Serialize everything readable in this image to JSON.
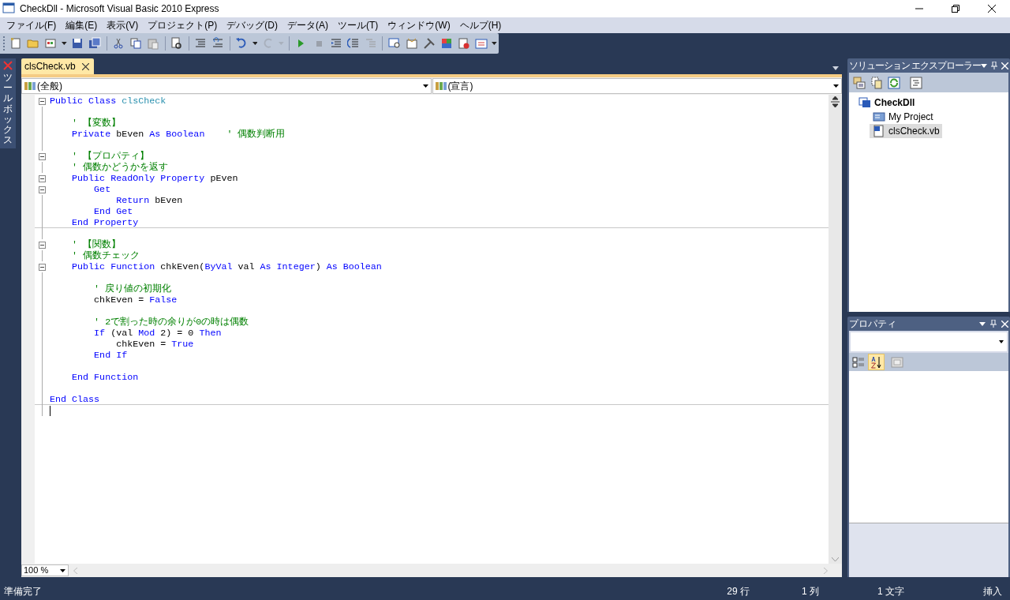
{
  "window": {
    "title": "CheckDll - Microsoft Visual Basic 2010 Express"
  },
  "menu": [
    "ファイル(F)",
    "編集(E)",
    "表示(V)",
    "プロジェクト(P)",
    "デバッグ(D)",
    "データ(A)",
    "ツール(T)",
    "ウィンドウ(W)",
    "ヘルプ(H)"
  ],
  "toolbox_tab": "ツールボックス",
  "document_tabs": [
    {
      "label": "clsCheck.vb",
      "selected": true
    }
  ],
  "editor": {
    "object_dropdown": "(全般)",
    "member_dropdown": "(宣言)",
    "zoom": "100 %",
    "lines": [
      {
        "fold": true,
        "separator": false,
        "tokens": [
          {
            "kind": "keyword",
            "text": "Public Class "
          },
          {
            "kind": "type",
            "text": "clsCheck"
          }
        ]
      },
      {
        "fold": false,
        "separator": false
      },
      {
        "fold": false,
        "separator": false,
        "tokens": [
          {
            "kind": "comment",
            "text": "    ' 【変数】"
          }
        ]
      },
      {
        "fold": false,
        "separator": false,
        "tokens": [
          {
            "kind": "keyword",
            "text": "    Private"
          },
          {
            "kind": "plain",
            "text": " bEven "
          },
          {
            "kind": "keyword",
            "text": "As Boolean"
          },
          {
            "kind": "comment",
            "text": "    ' 偶数判断用"
          }
        ]
      },
      {
        "fold": false,
        "separator": false
      },
      {
        "fold": true,
        "separator": false,
        "tokens": [
          {
            "kind": "comment",
            "text": "    ' 【プロパティ】"
          }
        ]
      },
      {
        "fold": false,
        "separator": false,
        "tokens": [
          {
            "kind": "comment",
            "text": "    ' 偶数かどうかを返す"
          }
        ]
      },
      {
        "fold": true,
        "separator": false,
        "tokens": [
          {
            "kind": "keyword",
            "text": "    Public ReadOnly Property"
          },
          {
            "kind": "plain",
            "text": " pEven"
          }
        ]
      },
      {
        "fold": true,
        "separator": false,
        "tokens": [
          {
            "kind": "keyword",
            "text": "        Get"
          }
        ]
      },
      {
        "fold": false,
        "separator": false,
        "tokens": [
          {
            "kind": "keyword",
            "text": "            Return"
          },
          {
            "kind": "plain",
            "text": " bEven"
          }
        ]
      },
      {
        "fold": false,
        "separator": false,
        "tokens": [
          {
            "kind": "keyword",
            "text": "        End Get"
          }
        ]
      },
      {
        "fold": false,
        "separator": true,
        "tokens": [
          {
            "kind": "keyword",
            "text": "    End Property"
          }
        ]
      },
      {
        "fold": false,
        "separator": false
      },
      {
        "fold": true,
        "separator": false,
        "tokens": [
          {
            "kind": "comment",
            "text": "    ' 【関数】"
          }
        ]
      },
      {
        "fold": false,
        "separator": false,
        "tokens": [
          {
            "kind": "comment",
            "text": "    ' 偶数チェック"
          }
        ]
      },
      {
        "fold": true,
        "separator": false,
        "tokens": [
          {
            "kind": "keyword",
            "text": "    Public Function"
          },
          {
            "kind": "plain",
            "text": " chkEven("
          },
          {
            "kind": "keyword",
            "text": "ByVal"
          },
          {
            "kind": "plain",
            "text": " val "
          },
          {
            "kind": "keyword",
            "text": "As Integer"
          },
          {
            "kind": "plain",
            "text": ") "
          },
          {
            "kind": "keyword",
            "text": "As Boolean"
          }
        ]
      },
      {
        "fold": false,
        "separator": false
      },
      {
        "fold": false,
        "separator": false,
        "tokens": [
          {
            "kind": "comment",
            "text": "        ' 戻り値の初期化"
          }
        ]
      },
      {
        "fold": false,
        "separator": false,
        "tokens": [
          {
            "kind": "plain",
            "text": "        chkEven = "
          },
          {
            "kind": "keyword",
            "text": "False"
          }
        ]
      },
      {
        "fold": false,
        "separator": false
      },
      {
        "fold": false,
        "separator": false,
        "tokens": [
          {
            "kind": "comment",
            "text": "        ' 2で割った時の余りが0の時は偶数"
          }
        ]
      },
      {
        "fold": false,
        "separator": false,
        "tokens": [
          {
            "kind": "keyword",
            "text": "        If"
          },
          {
            "kind": "plain",
            "text": " (val "
          },
          {
            "kind": "keyword",
            "text": "Mod"
          },
          {
            "kind": "plain",
            "text": " 2) = 0 "
          },
          {
            "kind": "keyword",
            "text": "Then"
          }
        ]
      },
      {
        "fold": false,
        "separator": false,
        "tokens": [
          {
            "kind": "plain",
            "text": "            chkEven = "
          },
          {
            "kind": "keyword",
            "text": "True"
          }
        ]
      },
      {
        "fold": false,
        "separator": false,
        "tokens": [
          {
            "kind": "keyword",
            "text": "        End If"
          }
        ]
      },
      {
        "fold": false,
        "separator": false
      },
      {
        "fold": false,
        "separator": false,
        "tokens": [
          {
            "kind": "keyword",
            "text": "    End Function"
          }
        ]
      },
      {
        "fold": false,
        "separator": false
      },
      {
        "fold": false,
        "separator": true,
        "tokens": [
          {
            "kind": "keyword",
            "text": "End Class"
          }
        ]
      }
    ]
  },
  "solution_explorer": {
    "title": "ソリューション エクスプローラー",
    "tree": [
      {
        "label": "CheckDll",
        "kind": "project",
        "selected": false,
        "children": [
          {
            "label": "My Project",
            "kind": "myproject",
            "selected": false
          },
          {
            "label": "clsCheck.vb",
            "kind": "vbfile",
            "selected": true
          }
        ]
      }
    ]
  },
  "properties": {
    "title": "プロパティ",
    "alphabetical": true
  },
  "status_bar": {
    "message": "準備完了",
    "line": "29 行",
    "column": "1 列",
    "char": "1 文字",
    "mode": "挿入"
  }
}
